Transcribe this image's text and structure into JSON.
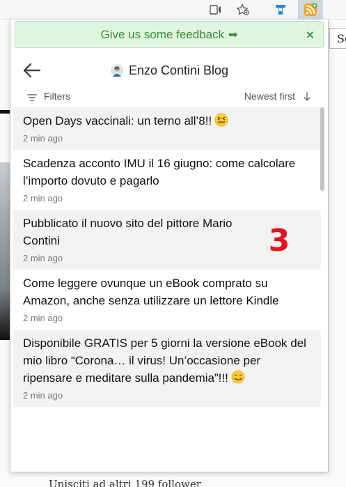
{
  "feedback": {
    "text": "Give us some feedback",
    "arrow": "➡",
    "close": "×"
  },
  "header": {
    "title": "Enzo Contini Blog"
  },
  "filters": {
    "label": "Filters",
    "sort": "Newest first"
  },
  "items": [
    {
      "title": "Open Days vaccinali: un terno all’8!!",
      "emoji": "confounded-face",
      "time": "2 min ago"
    },
    {
      "title": "Scadenza acconto IMU il 16 giugno: come calcolare l’importo dovuto e pagarlo",
      "time": "2 min ago"
    },
    {
      "title": "Pubblicato il nuovo sito del pittore Mario Contini",
      "time": "2 min ago"
    },
    {
      "title": "Come leggere ovunque un eBook comprato su Amazon, anche senza utilizzare un lettore Kindle",
      "time": "2 min ago"
    },
    {
      "title": "Disponibile GRATIS per 5 giorni la versione eBook del mio libro “Corona… il virus! Un’occasione per ripensare e meditare sulla pandemia”!!!",
      "emoji": "face-savoring-food",
      "time": "2 min ago"
    }
  ],
  "annotation": {
    "text": "3",
    "color": "#e0141e"
  },
  "background": {
    "search_fragment": "Se",
    "footer": "Unisciti ad altri 199 follower"
  },
  "colors": {
    "feedback_bg": "#dff5df",
    "feedback_text": "#3d8a3d",
    "rss_orange": "#f5a623",
    "ext_blue": "#2a8adf"
  }
}
